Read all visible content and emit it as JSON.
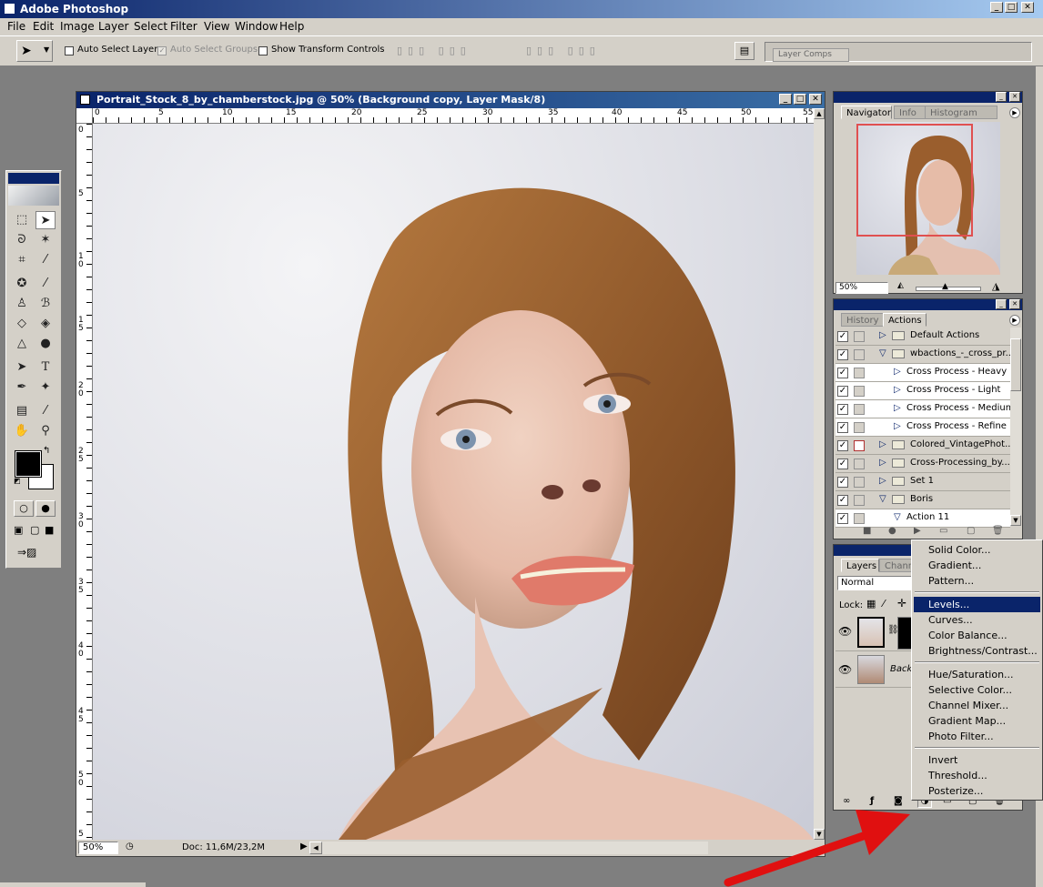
{
  "app": {
    "title": "Adobe Photoshop"
  },
  "menubar": [
    "File",
    "Edit",
    "Image",
    "Layer",
    "Select",
    "Filter",
    "View",
    "Window",
    "Help"
  ],
  "options_bar": {
    "auto_select_layer": "Auto Select Layer",
    "auto_select_groups": "Auto Select Groups",
    "show_transform_controls": "Show Transform Controls",
    "layer_comps_tab": "Layer Comps"
  },
  "document": {
    "title": "Portrait_Stock_8_by_chamberstock.jpg @ 50% (Background copy, Layer Mask/8)",
    "ruler_top": [
      "0",
      "5",
      "10",
      "15",
      "20",
      "25",
      "30",
      "35",
      "40",
      "45",
      "50",
      "55"
    ],
    "ruler_left": [
      "0",
      "5",
      "1 0",
      "1 5",
      "2 0",
      "2 5",
      "3 0",
      "3 5",
      "4 0",
      "4 5",
      "5 0",
      "5"
    ],
    "zoom": "50%",
    "doc_size": "Doc: 11,6M/23,2M"
  },
  "navigator": {
    "tabs": [
      "Navigator",
      "Info",
      "Histogram"
    ],
    "zoom": "50%"
  },
  "actions": {
    "tabs": [
      "History",
      "Actions"
    ],
    "rows": [
      {
        "label": "Default Actions",
        "level": 0,
        "kind": "set",
        "expanded": false
      },
      {
        "label": "wbactions_-_cross_pr...",
        "level": 0,
        "kind": "set",
        "expanded": true
      },
      {
        "label": "Cross Process - Heavy",
        "level": 1,
        "kind": "action",
        "expanded": false
      },
      {
        "label": "Cross Process - Light",
        "level": 1,
        "kind": "action",
        "expanded": false
      },
      {
        "label": "Cross Process - Medium",
        "level": 1,
        "kind": "action",
        "expanded": false
      },
      {
        "label": "Cross Process - Refine",
        "level": 1,
        "kind": "action",
        "expanded": false
      },
      {
        "label": "Colored_VintagePhot...",
        "level": 0,
        "kind": "set",
        "expanded": false
      },
      {
        "label": "Cross-Processing_by...",
        "level": 0,
        "kind": "set",
        "expanded": false
      },
      {
        "label": "Set 1",
        "level": 0,
        "kind": "set",
        "expanded": false
      },
      {
        "label": "Boris",
        "level": 0,
        "kind": "set",
        "expanded": true
      },
      {
        "label": "Action 11",
        "level": 1,
        "kind": "action",
        "expanded": true
      }
    ]
  },
  "layers": {
    "tabs": [
      "Layers",
      "Chann"
    ],
    "blend_mode": "Normal",
    "lock_label": "Lock:",
    "background_label": "Backg"
  },
  "adjustment_menu": {
    "groups": [
      [
        "Solid Color...",
        "Gradient...",
        "Pattern..."
      ],
      [
        "Levels...",
        "Curves...",
        "Color Balance...",
        "Brightness/Contrast..."
      ],
      [
        "Hue/Saturation...",
        "Selective Color...",
        "Channel Mixer...",
        "Gradient Map...",
        "Photo Filter..."
      ],
      [
        "Invert",
        "Threshold...",
        "Posterize..."
      ]
    ],
    "highlighted": "Levels..."
  },
  "colors": {
    "title_blue": "#0a246a",
    "chrome": "#d4d0c8",
    "arrow_red": "#e01010",
    "nav_view_box": "#e05050"
  }
}
